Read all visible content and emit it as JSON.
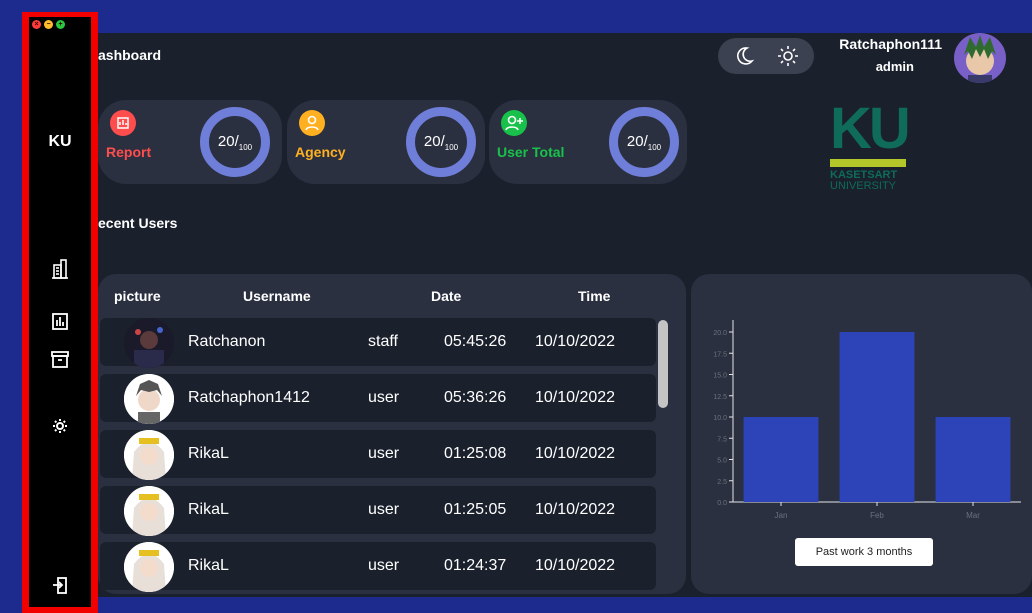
{
  "window": {
    "controls": [
      "close",
      "minimize",
      "maximize"
    ]
  },
  "sidebar": {
    "logo": "KU",
    "items": [
      {
        "icon": "building-icon"
      },
      {
        "icon": "bar-chart-icon"
      },
      {
        "icon": "archive-icon"
      },
      {
        "icon": "gear-icon"
      }
    ],
    "logout_icon": "logout-icon"
  },
  "header": {
    "title": "ashboard",
    "user_name": "Ratchaphon111",
    "user_role": "admin"
  },
  "stats": [
    {
      "label": "Report",
      "value": "20",
      "total": "100",
      "color": "#ff4d4d"
    },
    {
      "label": "Agency",
      "value": "20",
      "total": "100",
      "color": "#ffb020"
    },
    {
      "label": "User Total",
      "value": "20",
      "total": "100",
      "color": "#18c24a"
    }
  ],
  "brand": {
    "logo": "KU",
    "name_line1": "KASETSART",
    "name_line2": "UNIVERSITY"
  },
  "recent_users": {
    "title": "ecent Users",
    "columns": [
      "picture",
      "Username",
      "Date",
      "Time"
    ],
    "rows": [
      {
        "username": "Ratchanon",
        "role": "staff",
        "time": "05:45:26",
        "date": "10/10/2022"
      },
      {
        "username": "Ratchaphon1412",
        "role": "user",
        "time": "05:36:26",
        "date": "10/10/2022"
      },
      {
        "username": "RikaL",
        "role": "user",
        "time": "01:25:08",
        "date": "10/10/2022"
      },
      {
        "username": "RikaL",
        "role": "user",
        "time": "01:25:05",
        "date": "10/10/2022"
      },
      {
        "username": "RikaL",
        "role": "user",
        "time": "01:24:37",
        "date": "10/10/2022"
      }
    ]
  },
  "chart_data": {
    "type": "bar",
    "categories": [
      "Jan",
      "Feb",
      "Mar"
    ],
    "values": [
      10,
      20,
      10
    ],
    "ylim": [
      0,
      20
    ],
    "yticks": [
      "0.0",
      "2.5",
      "5.0",
      "7.5",
      "10.0",
      "12.5",
      "15.0",
      "17.5",
      "20.0"
    ],
    "bar_color": "#2c44b8",
    "grid": false,
    "button_label": "Past work 3 months"
  }
}
